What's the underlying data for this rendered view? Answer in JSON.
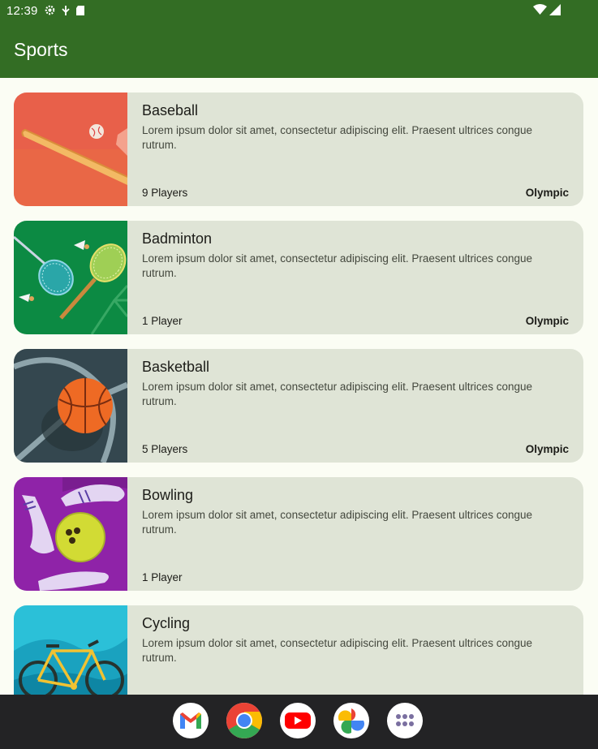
{
  "status_bar": {
    "time": "12:39"
  },
  "app_bar": {
    "title": "Sports"
  },
  "sports": [
    {
      "name": "Baseball",
      "description": "Lorem ipsum dolor sit amet, consectetur adipiscing elit. Praesent ultrices congue rutrum.",
      "players": "9 Players",
      "olympic": "Olympic"
    },
    {
      "name": "Badminton",
      "description": "Lorem ipsum dolor sit amet, consectetur adipiscing elit. Praesent ultrices congue rutrum.",
      "players": "1 Player",
      "olympic": "Olympic"
    },
    {
      "name": "Basketball",
      "description": "Lorem ipsum dolor sit amet, consectetur adipiscing elit. Praesent ultrices congue rutrum.",
      "players": "5 Players",
      "olympic": "Olympic"
    },
    {
      "name": "Bowling",
      "description": "Lorem ipsum dolor sit amet, consectetur adipiscing elit. Praesent ultrices congue rutrum.",
      "players": "1 Player",
      "olympic": ""
    },
    {
      "name": "Cycling",
      "description": "Lorem ipsum dolor sit amet, consectetur adipiscing elit. Praesent ultrices congue rutrum.",
      "players": "",
      "olympic": ""
    }
  ],
  "dock": [
    {
      "icon": "gmail-icon"
    },
    {
      "icon": "chrome-icon"
    },
    {
      "icon": "youtube-icon"
    },
    {
      "icon": "photos-icon"
    },
    {
      "icon": "app-drawer-icon"
    }
  ],
  "colors": {
    "primary": "#336d24",
    "card": "#dfe4d6",
    "background": "#fbfdf4",
    "nav": "#232325"
  }
}
